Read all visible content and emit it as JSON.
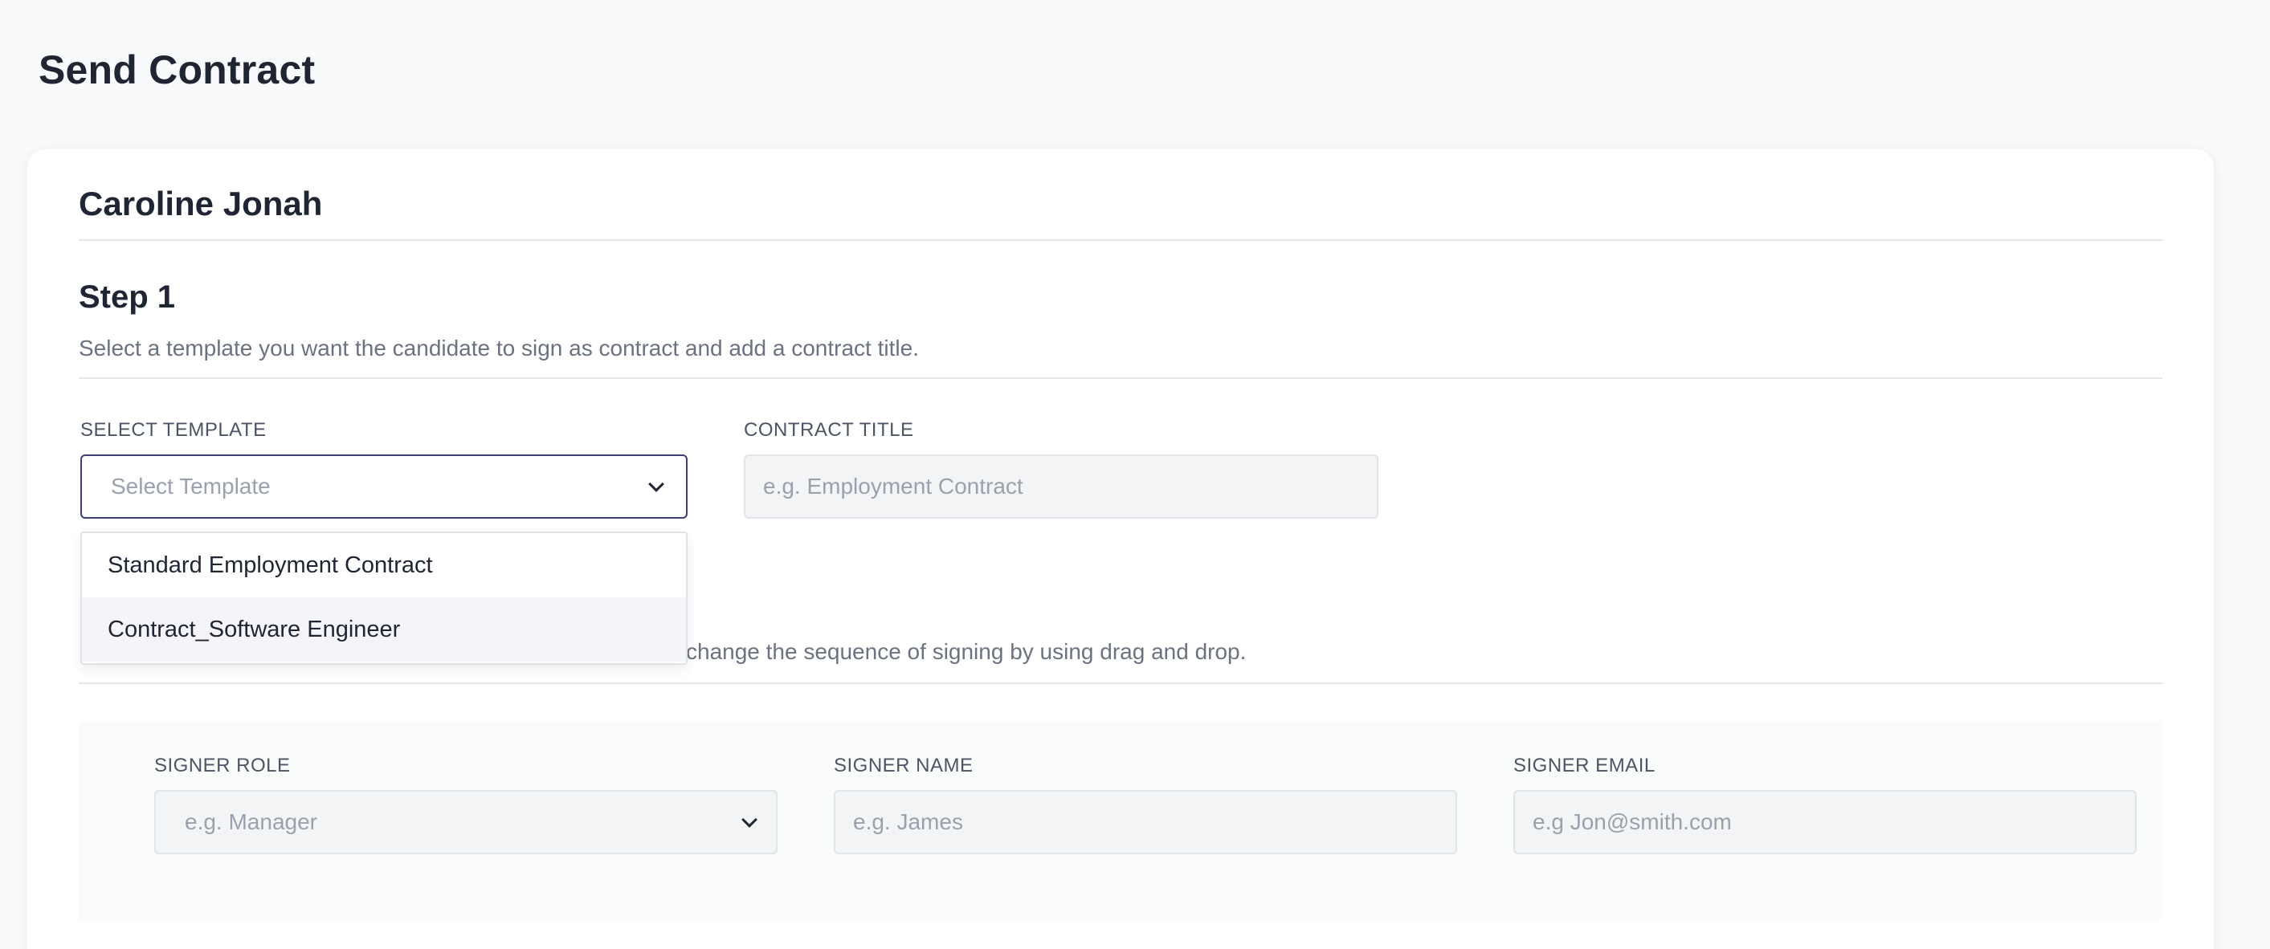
{
  "page": {
    "title": "Send Contract"
  },
  "candidate": {
    "name": "Caroline Jonah"
  },
  "step1": {
    "title": "Step 1",
    "description": "Select a template you want the candidate to sign as contract and add a contract title.",
    "template_label": "SELECT TEMPLATE",
    "template_placeholder": "Select Template",
    "template_options": [
      "Standard Employment Contract",
      "Contract_Software Engineer"
    ],
    "highlighted_option": "Contract_Software Engineer",
    "contract_title_label": "CONTRACT TITLE",
    "contract_title_placeholder": "e.g. Employment Contract"
  },
  "step2": {
    "description_visible": "change the sequence of signing by using drag and drop.",
    "signer_role_label": "SIGNER ROLE",
    "signer_role_placeholder": "e.g. Manager",
    "signer_name_label": "SIGNER NAME",
    "signer_name_placeholder": "e.g. James",
    "signer_email_label": "SIGNER EMAIL",
    "signer_email_placeholder": "e.g Jon@smith.com"
  },
  "colors": {
    "accent_border": "#3b3f74",
    "text_primary": "#1f2533",
    "text_muted": "#6b7280",
    "placeholder": "#9aa1ad"
  },
  "icons": [
    "chevron-down-icon"
  ]
}
